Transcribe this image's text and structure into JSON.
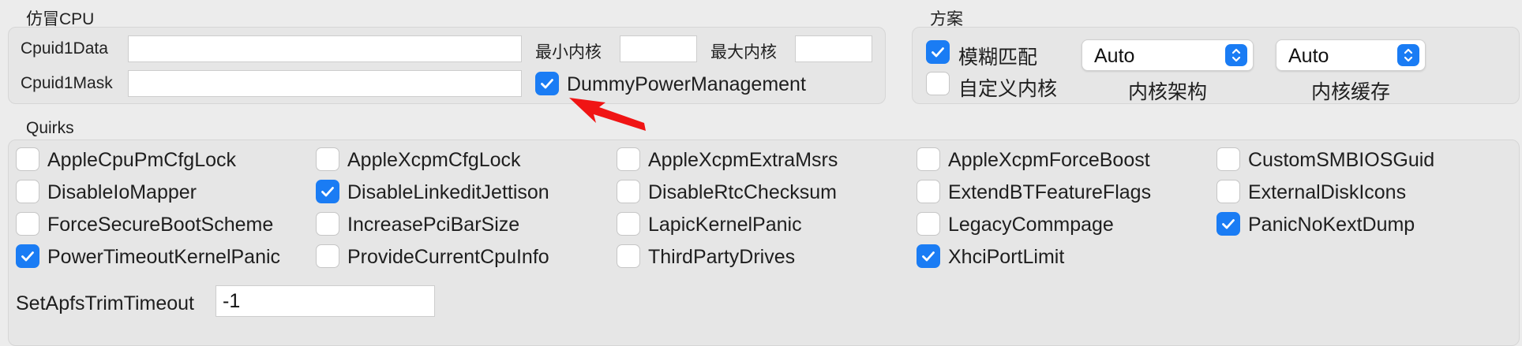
{
  "emulate": {
    "title": "仿冒CPU",
    "cpuid1data_label": "Cpuid1Data",
    "cpuid1data_value": "",
    "cpuid1mask_label": "Cpuid1Mask",
    "cpuid1mask_value": "",
    "min_kernel_label": "最小内核",
    "min_kernel_value": "",
    "max_kernel_label": "最大内核",
    "max_kernel_value": "",
    "dummy_power_label": "DummyPowerManagement",
    "dummy_power_checked": true
  },
  "scheme": {
    "title": "方案",
    "fuzzy_match_label": "模糊匹配",
    "fuzzy_match_checked": true,
    "custom_kernel_label": "自定义内核",
    "custom_kernel_checked": false,
    "kernel_arch_value": "Auto",
    "kernel_arch_label": "内核架构",
    "kernel_cache_value": "Auto",
    "kernel_cache_label": "内核缓存"
  },
  "quirks": {
    "title": "Quirks",
    "items": [
      {
        "label": "AppleCpuPmCfgLock",
        "checked": false
      },
      {
        "label": "AppleXcpmCfgLock",
        "checked": false
      },
      {
        "label": "AppleXcpmExtraMsrs",
        "checked": false
      },
      {
        "label": "AppleXcpmForceBoost",
        "checked": false
      },
      {
        "label": "CustomSMBIOSGuid",
        "checked": false
      },
      {
        "label": "DisableIoMapper",
        "checked": false
      },
      {
        "label": "DisableLinkeditJettison",
        "checked": true
      },
      {
        "label": "DisableRtcChecksum",
        "checked": false
      },
      {
        "label": "ExtendBTFeatureFlags",
        "checked": false
      },
      {
        "label": "ExternalDiskIcons",
        "checked": false
      },
      {
        "label": "ForceSecureBootScheme",
        "checked": false
      },
      {
        "label": "IncreasePciBarSize",
        "checked": false
      },
      {
        "label": "LapicKernelPanic",
        "checked": false
      },
      {
        "label": "LegacyCommpage",
        "checked": false
      },
      {
        "label": "PanicNoKextDump",
        "checked": true
      },
      {
        "label": "PowerTimeoutKernelPanic",
        "checked": true
      },
      {
        "label": "ProvideCurrentCpuInfo",
        "checked": false
      },
      {
        "label": "ThirdPartyDrives",
        "checked": false
      },
      {
        "label": "XhciPortLimit",
        "checked": true
      }
    ],
    "trim_label": "SetApfsTrimTimeout",
    "trim_value": "-1"
  },
  "colors": {
    "accent": "#1a7cf4",
    "annotation_arrow": "#f01414"
  }
}
